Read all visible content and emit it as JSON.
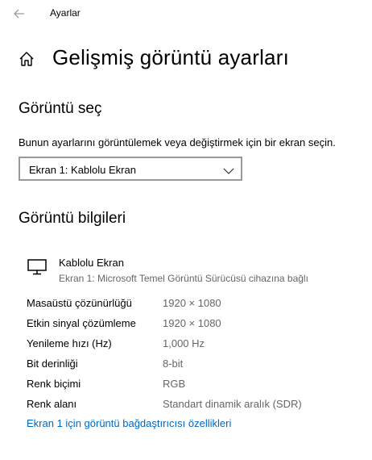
{
  "titlebar": {
    "title": "Ayarlar",
    "back_icon": "back-arrow-icon"
  },
  "page": {
    "title": "Gelişmiş görüntü ayarları",
    "home_icon": "home-icon"
  },
  "select_display": {
    "heading": "Görüntü seç",
    "description": "Bunun ayarlarını görüntülemek veya değiştirmek için bir ekran seçin.",
    "selected": "Ekran 1: Kablolu Ekran"
  },
  "display_info": {
    "heading": "Görüntü bilgileri",
    "display_name": "Kablolu Ekran",
    "display_subtitle": "Ekran 1: Microsoft Temel Görüntü Sürücüsü cihazına bağlı",
    "rows": [
      {
        "label": "Masaüstü çözünürlüğü",
        "value": "1920 × 1080"
      },
      {
        "label": "Etkin sinyal çözümleme",
        "value": "1920 × 1080"
      },
      {
        "label": "Yenileme hızı (Hz)",
        "value": "1,000 Hz"
      },
      {
        "label": "Bit derinliği",
        "value": "8-bit"
      },
      {
        "label": "Renk biçimi",
        "value": "RGB"
      },
      {
        "label": "Renk alanı",
        "value": "Standart dinamik aralık (SDR)"
      }
    ],
    "adapter_link": "Ekran 1 için görüntü bağdaştırıcısı özellikleri"
  },
  "colors": {
    "accent_link": "#0067c0",
    "secondary_text": "#666666",
    "border": "#999999"
  }
}
